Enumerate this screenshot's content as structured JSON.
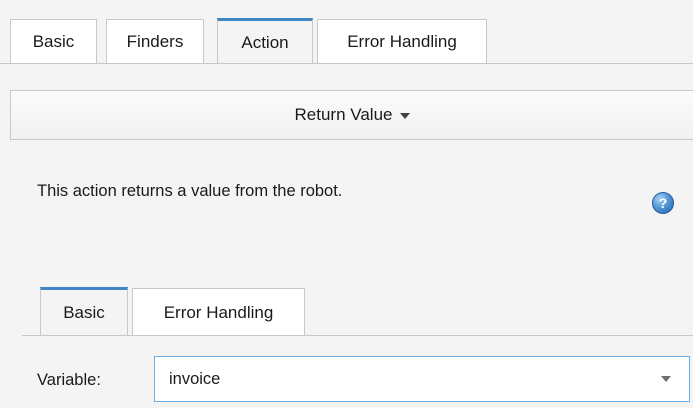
{
  "top_tabs": [
    "Basic",
    "Finders",
    "Action",
    "Error Handling"
  ],
  "active_top_tab": "Action",
  "action": {
    "selected": "Return Value",
    "description": "This action returns a value from the robot."
  },
  "help_icon": "question-circle-icon",
  "inner_tabs": [
    "Basic",
    "Error Handling"
  ],
  "active_inner_tab": "Basic",
  "variable": {
    "label": "Variable:",
    "value": "invoice"
  },
  "colors": {
    "active_tab_accent": "#3d86c5",
    "focus_border": "#6aaee4",
    "help_icon": "#4f95d6"
  }
}
